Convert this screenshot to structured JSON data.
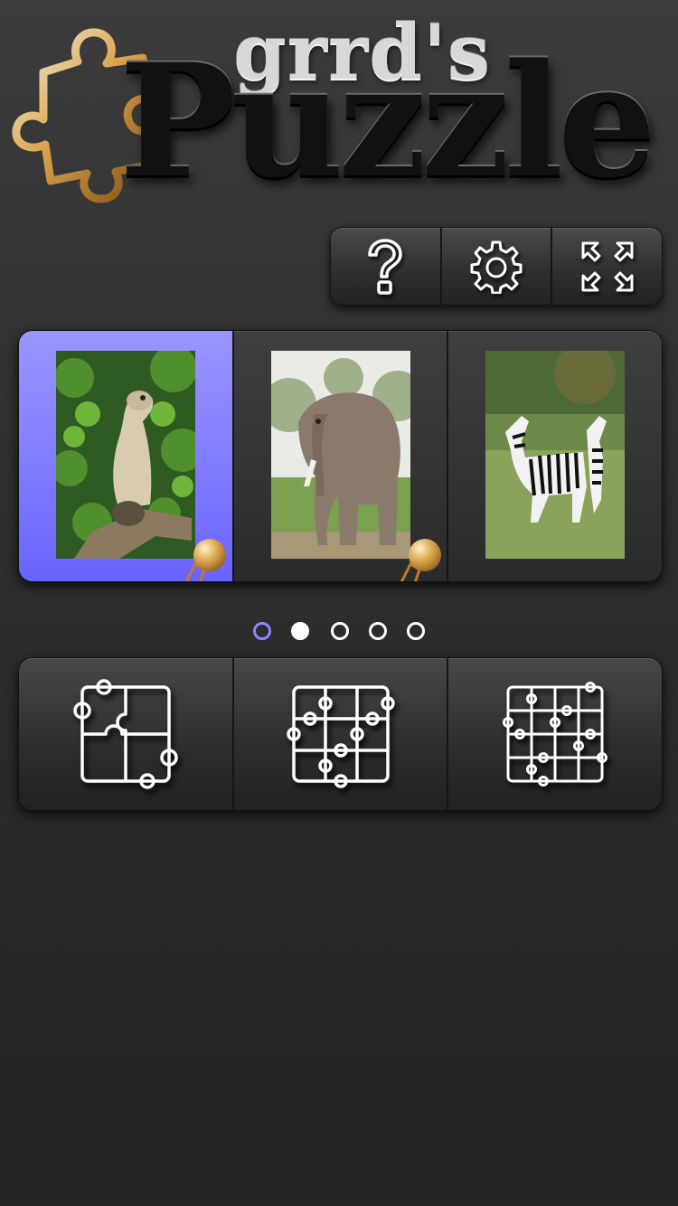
{
  "logo": {
    "small_text": "grrd's",
    "big_text": "Puzzle"
  },
  "toolbar": {
    "buttons": [
      {
        "name": "help",
        "icon": "help-icon"
      },
      {
        "name": "settings",
        "icon": "gear-icon"
      },
      {
        "name": "fullscreen",
        "icon": "fullscreen-icon"
      }
    ]
  },
  "pictures": [
    {
      "subject": "meerkat",
      "selected": true,
      "medal": true
    },
    {
      "subject": "elephant",
      "selected": false,
      "medal": true
    },
    {
      "subject": "zebras",
      "selected": false,
      "medal": false
    }
  ],
  "pagination": {
    "count": 5,
    "current": 1
  },
  "difficulty": [
    {
      "name": "easy",
      "icon": "puzzle-pieces-small-icon"
    },
    {
      "name": "medium",
      "icon": "puzzle-pieces-medium-icon"
    },
    {
      "name": "hard",
      "icon": "puzzle-pieces-large-icon"
    }
  ],
  "colors": {
    "accent": "#7a72ff",
    "medal": "#d9a44a"
  }
}
